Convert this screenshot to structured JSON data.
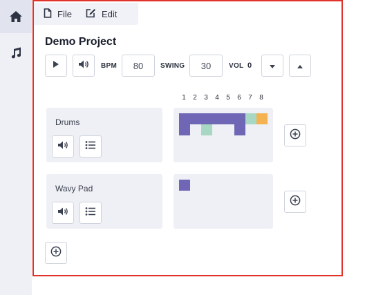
{
  "sidebar": {
    "items": [
      {
        "icon": "home-icon",
        "active": true
      },
      {
        "icon": "music-note-icon",
        "active": false
      }
    ]
  },
  "menu": {
    "file_label": "File",
    "edit_label": "Edit"
  },
  "project": {
    "title": "Demo Project"
  },
  "transport": {
    "bpm_label": "BPM",
    "bpm_value": "80",
    "swing_label": "SWING",
    "swing_value": "30",
    "vol_label": "VOL",
    "vol_value": "0"
  },
  "step_numbers": [
    "1",
    "2",
    "3",
    "4",
    "5",
    "6",
    "7",
    "8"
  ],
  "colors": {
    "accent_purple": "#6f66b6",
    "accent_mint": "#a8d8c3",
    "accent_orange": "#f4b350",
    "frame_red": "#e0312b"
  },
  "tracks": [
    {
      "name": "Drums",
      "pattern_rows": [
        [
          "purple",
          "purple",
          "purple",
          "purple",
          "purple",
          "purple",
          "mint",
          "orange"
        ],
        [
          "purple",
          "empty",
          "mint",
          "empty",
          "empty",
          "purple",
          "empty",
          "empty"
        ]
      ]
    },
    {
      "name": "Wavy Pad",
      "pattern_rows": [
        [
          "purple",
          "empty",
          "empty",
          "empty",
          "empty",
          "empty",
          "empty",
          "empty"
        ],
        [
          "empty",
          "empty",
          "empty",
          "empty",
          "empty",
          "empty",
          "empty",
          "empty"
        ]
      ]
    }
  ]
}
